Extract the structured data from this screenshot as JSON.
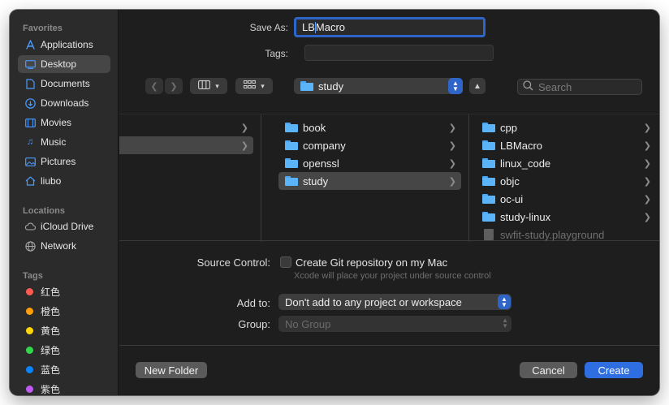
{
  "sidebar": {
    "favorites_label": "Favorites",
    "favorites": [
      {
        "label": "Applications",
        "icon": "applications-icon"
      },
      {
        "label": "Desktop",
        "icon": "desktop-icon",
        "selected": true
      },
      {
        "label": "Documents",
        "icon": "document-icon"
      },
      {
        "label": "Downloads",
        "icon": "download-icon"
      },
      {
        "label": "Movies",
        "icon": "film-icon"
      },
      {
        "label": "Music",
        "icon": "music-note-icon"
      },
      {
        "label": "Pictures",
        "icon": "photo-icon"
      },
      {
        "label": "liubo",
        "icon": "home-icon"
      }
    ],
    "locations_label": "Locations",
    "locations": [
      {
        "label": "iCloud Drive",
        "icon": "cloud-icon"
      },
      {
        "label": "Network",
        "icon": "globe-icon"
      }
    ],
    "tags_label": "Tags",
    "tags": [
      {
        "label": "红色",
        "color": "#ff5a52"
      },
      {
        "label": "橙色",
        "color": "#ff9f0a"
      },
      {
        "label": "黄色",
        "color": "#ffd60a"
      },
      {
        "label": "绿色",
        "color": "#32d74b"
      },
      {
        "label": "蓝色",
        "color": "#0a84ff"
      },
      {
        "label": "紫色",
        "color": "#bf5af2"
      }
    ]
  },
  "save_as": {
    "label": "Save As:",
    "value_before_caret": "LB",
    "value_after_caret": "Macro"
  },
  "tags_field": {
    "label": "Tags:",
    "value": ""
  },
  "toolbar": {
    "back_icon": "chevron-left-icon",
    "forward_icon": "chevron-right-icon",
    "view_icon": "columns-view-icon",
    "group_icon": "grid-group-icon",
    "path": "study",
    "search_placeholder": "Search"
  },
  "browser": {
    "column2": [
      {
        "label": "book",
        "has_children": true
      },
      {
        "label": "company",
        "has_children": true
      },
      {
        "label": "openssl",
        "has_children": true
      },
      {
        "label": "study",
        "has_children": true,
        "selected": true
      }
    ],
    "column3": [
      {
        "label": "cpp",
        "has_children": true
      },
      {
        "label": "LBMacro",
        "has_children": true
      },
      {
        "label": "linux_code",
        "has_children": true
      },
      {
        "label": "objc",
        "has_children": true
      },
      {
        "label": "oc-ui",
        "has_children": true
      },
      {
        "label": "study-linux",
        "has_children": true
      },
      {
        "label": "swfit-study.playground",
        "has_children": false,
        "disabled": true
      }
    ]
  },
  "source_control": {
    "label": "Source Control:",
    "checkbox_label": "Create Git repository on my Mac",
    "hint": "Xcode will place your project under source control",
    "checked": false
  },
  "add_to": {
    "label": "Add to:",
    "value": "Don't add to any project or workspace"
  },
  "group": {
    "label": "Group:",
    "value": "No Group"
  },
  "buttons": {
    "new_folder": "New Folder",
    "cancel": "Cancel",
    "create": "Create"
  }
}
